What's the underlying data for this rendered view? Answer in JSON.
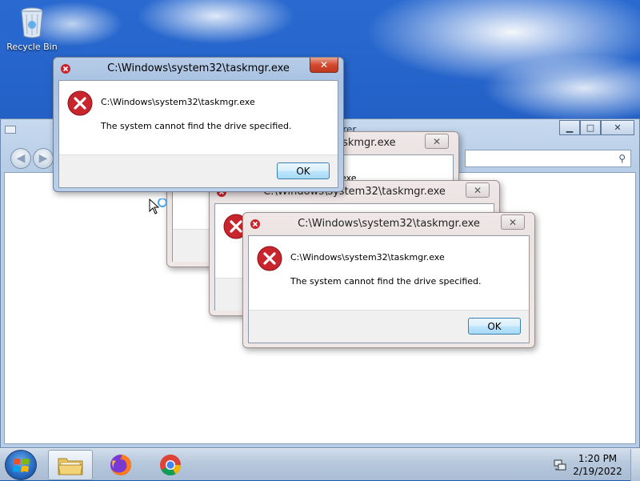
{
  "desktop": {
    "icons": [
      {
        "label": "Recycle Bin",
        "icon": "recycle-bin-icon"
      }
    ]
  },
  "explorer": {
    "title_fragment": "orer",
    "obscured_path": "exe"
  },
  "dialogs": [
    {
      "state": "active",
      "title": "C:\\Windows\\system32\\taskmgr.exe",
      "path": "C:\\Windows\\system32\\taskmgr.exe",
      "message": "The system cannot find the drive specified.",
      "ok_label": "OK",
      "icon": "error-icon"
    },
    {
      "state": "inactive",
      "title": "taskmgr.exe",
      "path": "",
      "message": "",
      "ok_label": "",
      "icon": "error-icon"
    },
    {
      "state": "inactive",
      "title": "C:\\Windows\\system32\\taskmgr.exe",
      "path": "",
      "message": "",
      "ok_label": "",
      "icon": "error-icon"
    },
    {
      "state": "inactive",
      "title": "C:\\Windows\\system32\\taskmgr.exe",
      "path": "C:\\Windows\\system32\\taskmgr.exe",
      "message": "The system cannot find the drive specified.",
      "ok_label": "OK",
      "icon": "error-icon"
    }
  ],
  "taskbar": {
    "items": [
      {
        "name": "windows-explorer",
        "icon": "folder-icon",
        "active": true
      },
      {
        "name": "firefox",
        "icon": "firefox-icon",
        "active": false
      },
      {
        "name": "chrome",
        "icon": "chrome-icon",
        "active": false
      }
    ],
    "clock": {
      "time": "1:20 PM",
      "date": "2/19/2022"
    },
    "tray_icons": [
      "network-icon"
    ]
  },
  "colors": {
    "error_red": "#c8252d",
    "ok_border": "#3c7fb1",
    "active_frame": "#b7cde8",
    "inactive_frame": "#ebe2e2"
  }
}
